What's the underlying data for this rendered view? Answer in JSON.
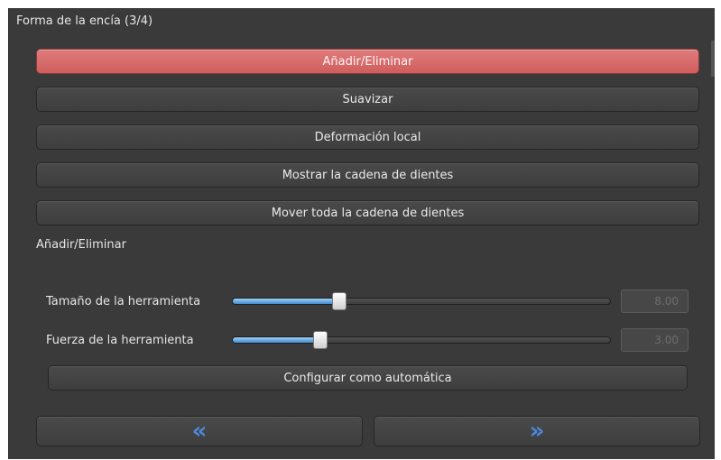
{
  "panel": {
    "title": "Forma de la encía (3/4)"
  },
  "buttons": [
    {
      "label": "Añadir/Eliminar",
      "active": true
    },
    {
      "label": "Suavizar",
      "active": false
    },
    {
      "label": "Deformación local",
      "active": false
    },
    {
      "label": "Mostrar la cadena de dientes",
      "active": false
    },
    {
      "label": "Mover toda la cadena de dientes",
      "active": false
    }
  ],
  "section": {
    "label": "Añadir/Eliminar"
  },
  "sliders": {
    "size": {
      "label": "Tamaño de la herramienta",
      "value": "8.00",
      "fraction": 0.28
    },
    "force": {
      "label": "Fuerza de la herramienta",
      "value": "3.00",
      "fraction": 0.23
    }
  },
  "auto_button": {
    "label": "Configurar como automática"
  },
  "nav": {
    "prev_icon": "double-chevron-left-icon",
    "next_icon": "double-chevron-right-icon",
    "prev_glyph": "«",
    "next_glyph": "»"
  },
  "colors": {
    "active_button": "#d96a6a",
    "slider_fill": "#5aa6e6",
    "nav_arrow": "#4d87e0"
  }
}
